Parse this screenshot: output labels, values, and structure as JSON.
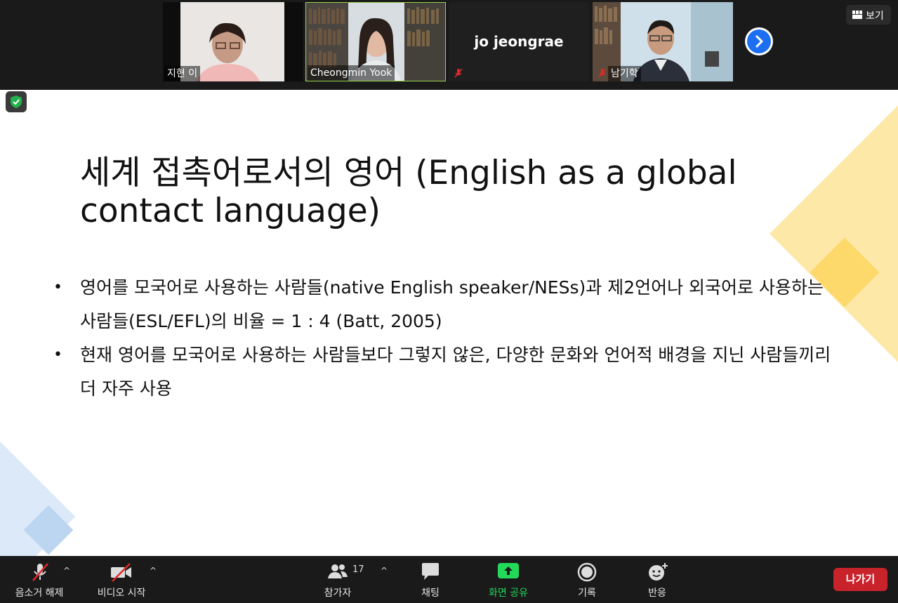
{
  "gallery": {
    "participants": [
      {
        "name": "지현 이"
      },
      {
        "name": "Cheongmin Yook"
      },
      {
        "display_name": "jo jeongrae"
      },
      {
        "name": "남기학"
      }
    ],
    "view_label": "보기"
  },
  "slide": {
    "title": "세계 접촉어로서의 영어 (English as a global contact language)",
    "bullets": [
      "영어를 모국어로 사용하는 사람들(native English speaker/NESs)과 제2언어나 외국어로 사용하는 사람들(ESL/EFL)의 비율 = 1 : 4 (Batt, 2005)",
      "현재 영어를 모국어로 사용하는 사람들보다 그렇지 않은, 다양한 문화와 언어적 배경을 지닌 사람들끼리 더 자주 사용"
    ]
  },
  "toolbar": {
    "unmute_label": "음소거 해제",
    "video_label": "비디오 시작",
    "participants_label": "참가자",
    "participants_count": "17",
    "chat_label": "채팅",
    "share_label": "화면 공유",
    "record_label": "기록",
    "reactions_label": "반응",
    "leave_label": "나가기"
  },
  "colors": {
    "share_accent": "#23d959",
    "leave_button": "#c8222b",
    "next_arrow": "#1d6ff2",
    "active_speaker_border": "#9bd34a"
  },
  "icons": [
    "shield-check-icon",
    "chevron-right-icon",
    "grid-view-icon",
    "mic-muted-icon",
    "video-off-icon",
    "participants-icon",
    "chat-icon",
    "share-screen-icon",
    "record-icon",
    "reaction-icon"
  ]
}
